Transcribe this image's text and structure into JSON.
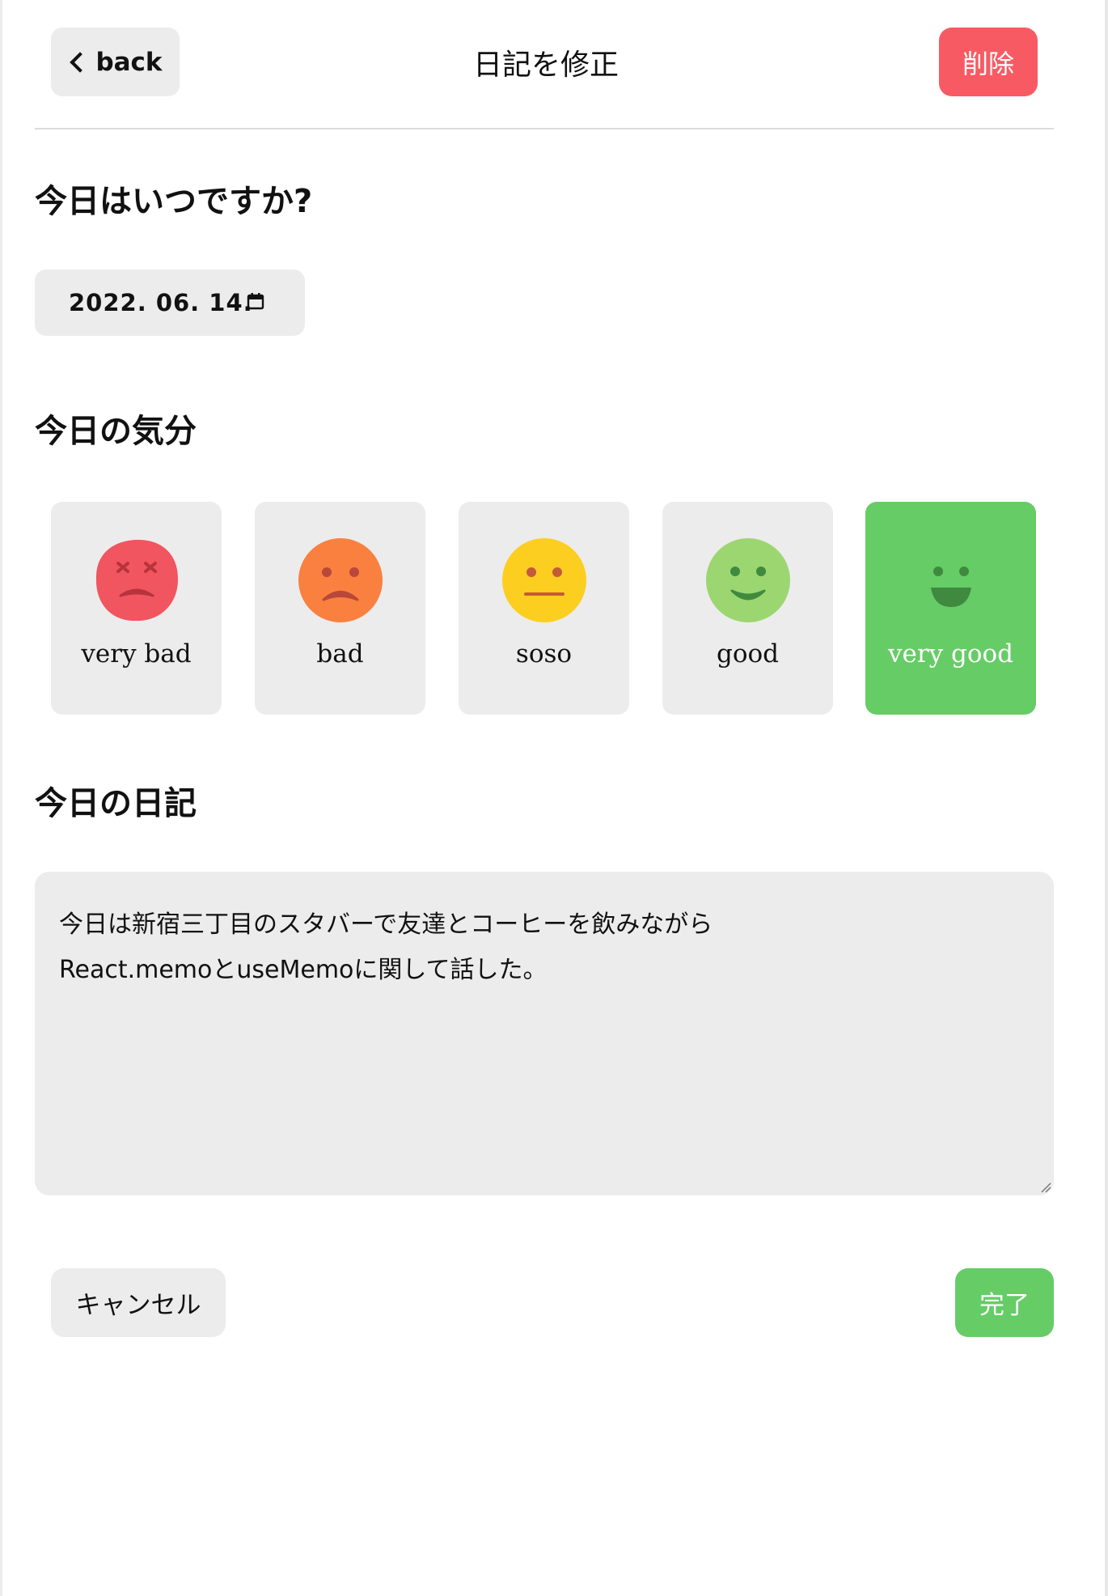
{
  "header": {
    "back_label": "back",
    "title": "日記を修正",
    "delete_label": "削除"
  },
  "date_section": {
    "title": "今日はいつですか?",
    "date_value": "2022. 06. 14."
  },
  "mood_section": {
    "title": "今日の気分",
    "selected": "very good",
    "moods": [
      {
        "label": "very bad",
        "face_color": "#f05560",
        "icon": "very-bad-face-icon"
      },
      {
        "label": "bad",
        "face_color": "#fa8040",
        "icon": "bad-face-icon"
      },
      {
        "label": "soso",
        "face_color": "#fcce20",
        "icon": "soso-face-icon"
      },
      {
        "label": "good",
        "face_color": "#9cd670",
        "icon": "good-face-icon"
      },
      {
        "label": "very good",
        "face_color": "#66cc66",
        "icon": "very-good-face-icon"
      }
    ]
  },
  "diary_section": {
    "title": "今日の日記",
    "content": "今日は新宿三丁目のスタバーで友達とコーヒーを飲みながら\nReact.memoとuseMemoに関して話した。"
  },
  "footer": {
    "cancel_label": "キャンセル",
    "done_label": "完了"
  },
  "colors": {
    "accent_green": "#66cc66",
    "delete_red": "#f85a63",
    "card_gray": "#ececec"
  }
}
